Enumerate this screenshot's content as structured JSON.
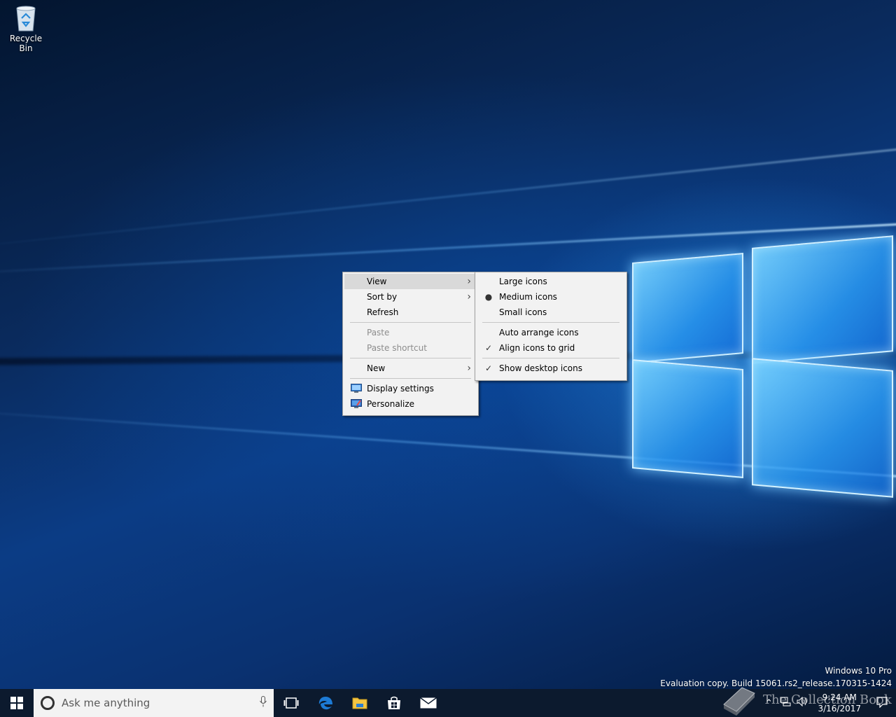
{
  "desktop": {
    "icons": [
      {
        "label": "Recycle Bin",
        "icon": "recycle-bin-icon"
      }
    ]
  },
  "context_menu": {
    "items": {
      "view": {
        "label": "View",
        "has_submenu": true,
        "highlighted": true
      },
      "sort_by": {
        "label": "Sort by",
        "has_submenu": true
      },
      "refresh": {
        "label": "Refresh"
      },
      "paste": {
        "label": "Paste",
        "disabled": true
      },
      "paste_shortcut": {
        "label": "Paste shortcut",
        "disabled": true
      },
      "new": {
        "label": "New",
        "has_submenu": true
      },
      "display_settings": {
        "label": "Display settings",
        "icon": "display-settings-icon"
      },
      "personalize": {
        "label": "Personalize",
        "icon": "personalize-icon"
      }
    }
  },
  "view_submenu": {
    "items": {
      "large_icons": {
        "label": "Large icons"
      },
      "medium_icons": {
        "label": "Medium icons",
        "mark": "●",
        "selected": true
      },
      "small_icons": {
        "label": "Small icons"
      },
      "auto_arrange": {
        "label": "Auto arrange icons"
      },
      "align_to_grid": {
        "label": "Align icons to grid",
        "mark": "✓",
        "checked": true
      },
      "show_desktop_icons": {
        "label": "Show desktop icons",
        "mark": "✓",
        "checked": true
      }
    }
  },
  "watermark": {
    "line1": "Windows 10 Pro",
    "line2": "Evaluation copy. Build 15061.rs2_release.170315-1424"
  },
  "taskbar": {
    "search_placeholder": "Ask me anything",
    "apps": [
      "task-view-icon",
      "edge-icon",
      "file-explorer-icon",
      "store-icon",
      "mail-icon"
    ],
    "clock": {
      "time": "9:24 AM",
      "date": "3/16/2017"
    },
    "brand_overlay": "The Collection Book"
  },
  "colors": {
    "taskbar_bg": "#0c1a2e",
    "menu_bg": "#f2f2f2",
    "menu_highlight": "#d9d9d9",
    "desktop_accent": "#0b3c85"
  }
}
